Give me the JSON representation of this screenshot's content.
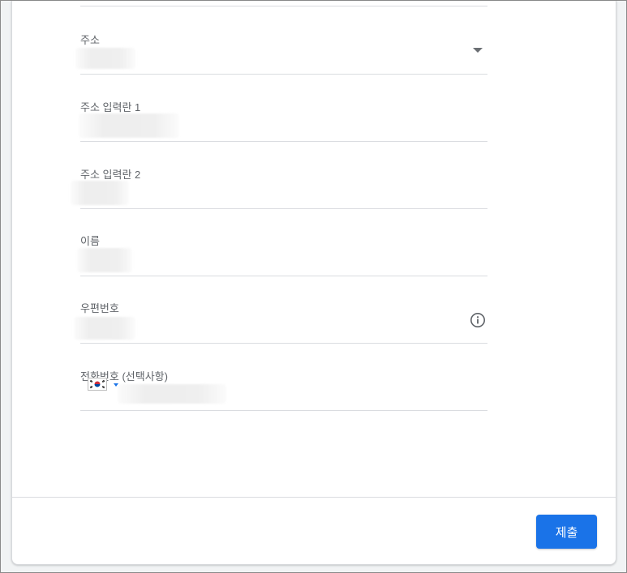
{
  "form": {
    "fields": [
      {
        "label": "주소",
        "type": "select"
      },
      {
        "label": "주소 입력란 1",
        "type": "text"
      },
      {
        "label": "주소 입력란 2",
        "type": "text"
      },
      {
        "label": "이름",
        "type": "text"
      },
      {
        "label": "우편번호",
        "type": "text",
        "icon": "info-icon"
      },
      {
        "label": "전화번호 (선택사항)",
        "type": "tel",
        "icon": "korea-flag-icon"
      }
    ]
  },
  "footer": {
    "submit_label": "제출"
  },
  "colors": {
    "accent": "#1a73e8",
    "label": "#5f6368",
    "divider": "#dadce0"
  }
}
